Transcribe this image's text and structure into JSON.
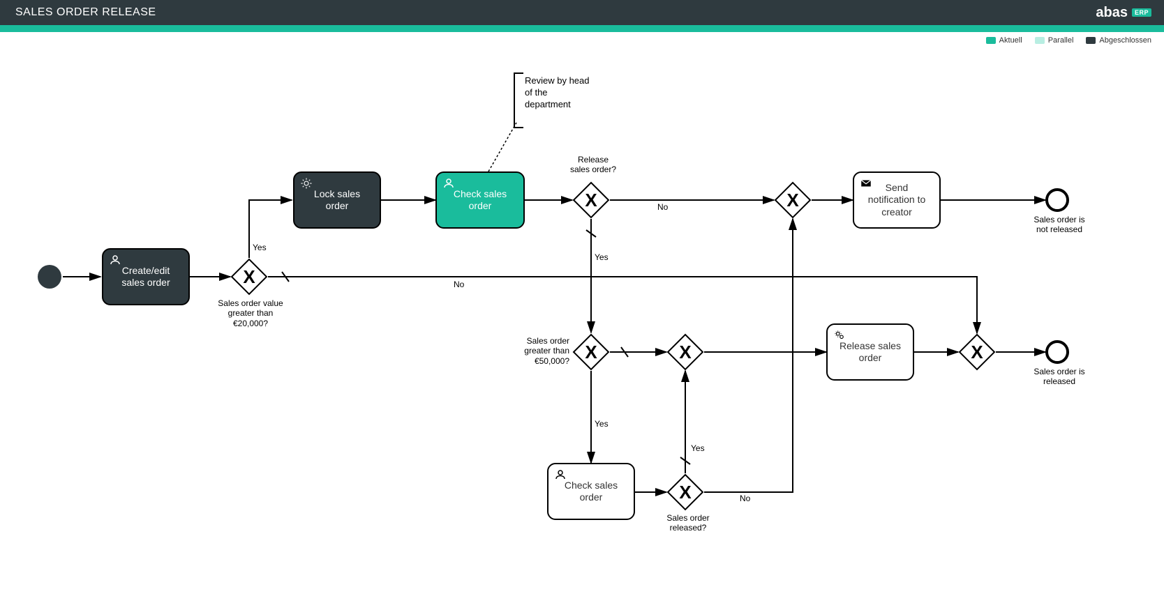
{
  "header": {
    "title": "SALES ORDER RELEASE",
    "brand_name": "abas",
    "brand_badge": "ERP"
  },
  "legend": {
    "aktuell": "Aktuell",
    "parallel": "Parallel",
    "abgeschlossen": "Abgeschlossen"
  },
  "nodes": {
    "create_edit": "Create/edit\nsales order",
    "lock": "Lock sales\norder",
    "check_1": "Check sales\norder",
    "check_2": "Check sales\norder",
    "release": "Release sales\norder",
    "notify": "Send\nnotification to\ncreator"
  },
  "gateways": {
    "g20k": "X",
    "g_release_q": "X",
    "g_merge_top": "X",
    "g_50k": "X",
    "g_merge_mid": "X",
    "g_released_q": "X",
    "g_merge_release": "X"
  },
  "annotation": {
    "text": "Review by head\nof the\ndepartment"
  },
  "edge_labels": {
    "yes_20k": "Yes",
    "no_20k": "No",
    "release_q": "Release\nsales order?",
    "no_release": "No",
    "yes_release": "Yes",
    "greater_50k": "Sales order\ngreater than\n€50,000?",
    "yes_50k": "Yes",
    "released_q": "Sales order\nreleased?",
    "yes_released": "Yes",
    "no_released": "No",
    "value_20k": "Sales order value\ngreater than\n€20,000?"
  },
  "end_labels": {
    "not_released": "Sales order is\nnot released",
    "released": "Sales order is\nreleased"
  },
  "colors": {
    "teal": "#1abc9c",
    "dark": "#2f3a3f",
    "pale": "#b8eee2"
  }
}
